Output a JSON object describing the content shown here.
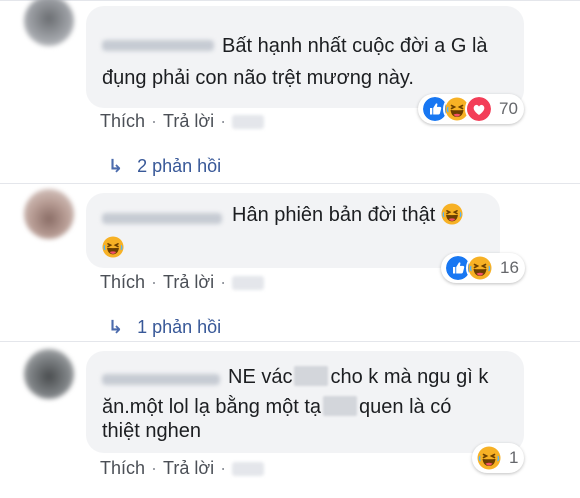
{
  "comments": [
    {
      "text_lines": [
        "Bất hạnh nhất cuộc đời a G là",
        "đụng phải con não trệt mương này."
      ],
      "reactions": {
        "icons": [
          "like-icon",
          "haha-icon",
          "love-icon"
        ],
        "count": "70"
      },
      "actions": {
        "like": "Thích",
        "reply": "Trả lời"
      },
      "replies": "2 phản hồi"
    },
    {
      "text_lines": [
        "Hân phiên bản đời thật"
      ],
      "reactions": {
        "icons": [
          "like-icon",
          "haha-icon"
        ],
        "count": "16"
      },
      "actions": {
        "like": "Thích",
        "reply": "Trả lời"
      },
      "replies": "1 phản hồi"
    },
    {
      "line1": {
        "a": "NE vác",
        "b": "cho k mà ngu gì k"
      },
      "line2": {
        "a": "ăn.một lol lạ bằng một tạ",
        "b": "quen là có"
      },
      "line3": "thiệt nghen",
      "reactions": {
        "icons": [
          "haha-icon"
        ],
        "count": "1"
      },
      "actions": {
        "like": "Thích",
        "reply": "Trả lời"
      }
    }
  ],
  "colors": {
    "like": "#1877f2",
    "love": "#f33e58",
    "haha": "#f7b125",
    "link": "#385898"
  }
}
